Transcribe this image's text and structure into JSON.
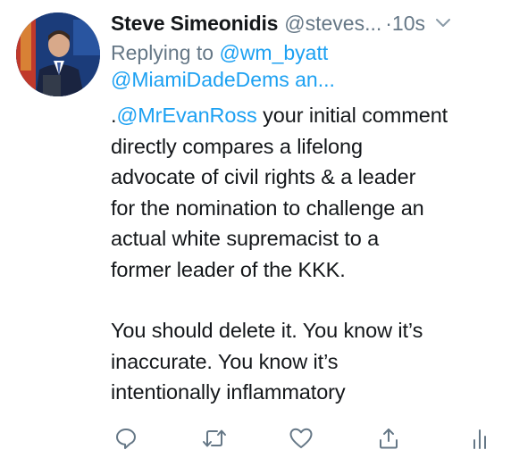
{
  "tweet": {
    "author_name": "Steve Simeonidis",
    "author_handle": "@steves...",
    "timestamp": "·10s",
    "replying_prefix": "Replying to ",
    "replying_to_1": "@wm_byatt",
    "replying_to_2": "@MiamiDadeDems an...",
    "mention_prefix": ".",
    "mention": "@MrEvanRoss",
    "line1_rest": " your initial comment",
    "lines_p1": [
      "directly compares a lifelong",
      "advocate of civil rights & a leader",
      "for the nomination to challenge an",
      "actual white supremacist to a",
      "former leader of the KKK."
    ],
    "lines_p2": [
      "You should delete it. You know it’s",
      "inaccurate. You know it’s",
      "intentionally inflammatory"
    ]
  },
  "actions": {
    "reply_icon": "reply-icon",
    "retweet_icon": "retweet-icon",
    "like_icon": "heart-icon",
    "share_icon": "share-icon",
    "analytics_icon": "analytics-icon"
  },
  "colors": {
    "link": "#1da1f2",
    "muted": "#657786",
    "text": "#14171a"
  }
}
